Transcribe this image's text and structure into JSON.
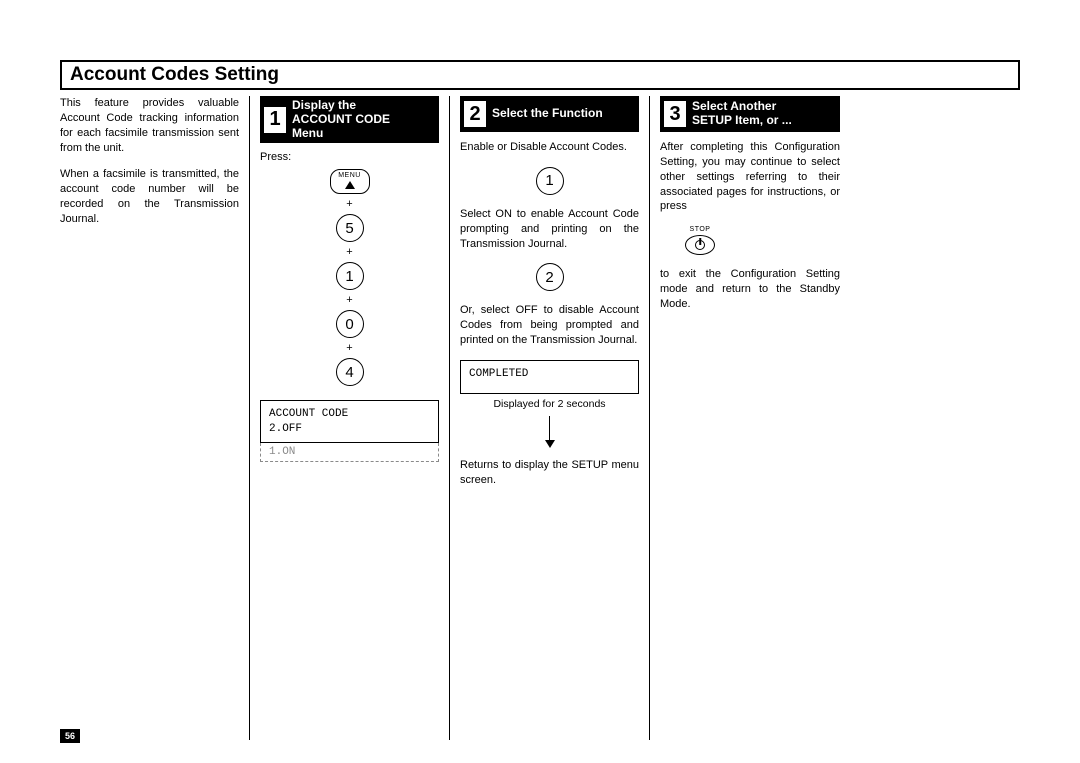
{
  "page": {
    "title": "Account Codes Setting",
    "number": "56"
  },
  "intro": {
    "p1": "This feature provides valuable Account Code tracking information for each facsimile transmission sent from the unit.",
    "p2": "When a facsimile is transmitted, the account code number will be recorded on the Transmission Journal."
  },
  "step1": {
    "num": "1",
    "title_line1": "Display the",
    "title_line2": "ACCOUNT CODE",
    "title_line3": "Menu",
    "press": "Press:",
    "menu_label": "MENU",
    "plus": "+",
    "keys": [
      "5",
      "1",
      "0",
      "4"
    ],
    "lcd_line1": "ACCOUNT CODE",
    "lcd_line2": "2.OFF",
    "lcd_ghost": "1.ON"
  },
  "step2": {
    "num": "2",
    "title": "Select the Function",
    "p1": "Enable or Disable Account Codes.",
    "key1": "1",
    "p2": "Select ON to enable Account Code prompting and printing on the Transmission Journal.",
    "key2": "2",
    "p3": "Or, select OFF to disable Account Codes from being prompted and printed on the Transmission Journal.",
    "lcd": "COMPLETED",
    "sub": "Displayed for 2 seconds",
    "p4": "Returns to display the SETUP menu screen."
  },
  "step3": {
    "num": "3",
    "title_line1": "Select Another",
    "title_line2": "SETUP Item, or ...",
    "p1": "After completing this Configuration Setting, you may continue to select other settings referring to their associated pages for instructions, or press",
    "stop_label": "STOP",
    "p2": "to exit the Configuration Setting mode and return to the Standby Mode."
  }
}
